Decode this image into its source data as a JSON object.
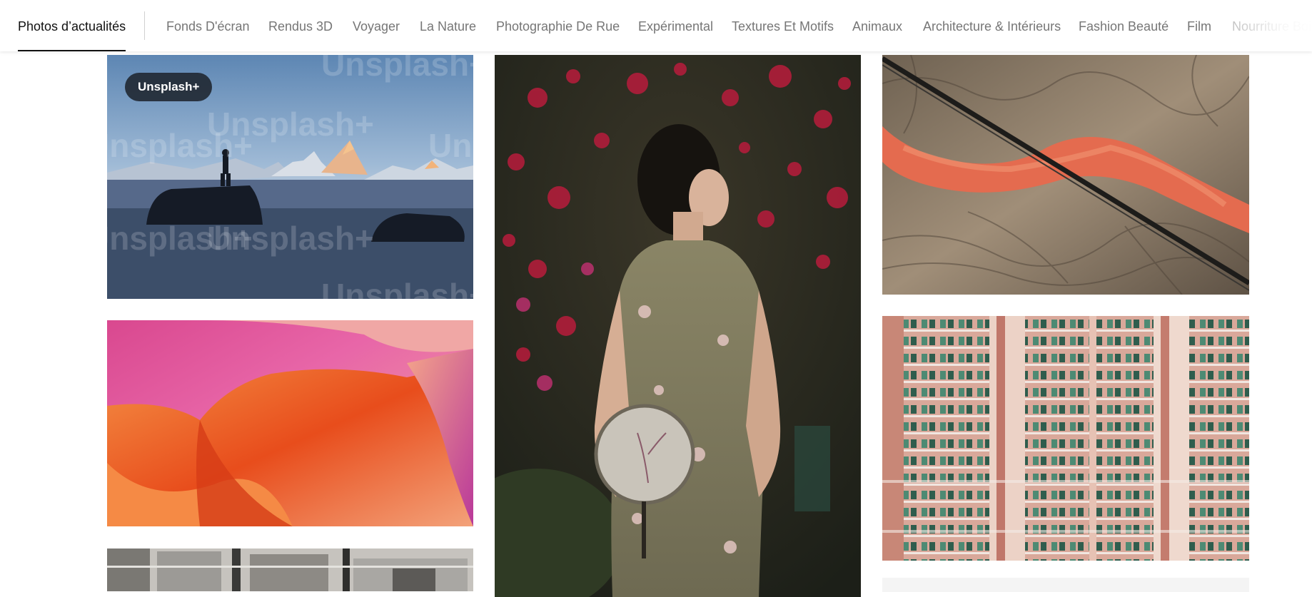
{
  "nav": {
    "tabs": [
      {
        "label": "Photos d’actualités",
        "active": true
      },
      {
        "label": "Fonds D'écran"
      },
      {
        "label": "Rendus 3D"
      },
      {
        "label": "Voyager"
      },
      {
        "label": "La Nature"
      },
      {
        "label": "Photographie De Rue"
      },
      {
        "label": "Expérimental"
      },
      {
        "label": "Textures Et Motifs"
      },
      {
        "label": "Animaux"
      },
      {
        "label": "Architecture & Intérieurs"
      },
      {
        "label": "Fashion Beauté"
      },
      {
        "label": "Film"
      },
      {
        "label": "Nourriture Boisson"
      }
    ]
  },
  "photos": {
    "mountain": {
      "badge": "Unsplash+",
      "watermark": "Unsplash+"
    },
    "abstract": {},
    "woman": {},
    "aerial": {},
    "building_top": {},
    "building_bottom": {}
  },
  "colors": {
    "active_tab": "#111111",
    "inactive_tab": "#767676",
    "badge_bg": "#1e242e"
  }
}
